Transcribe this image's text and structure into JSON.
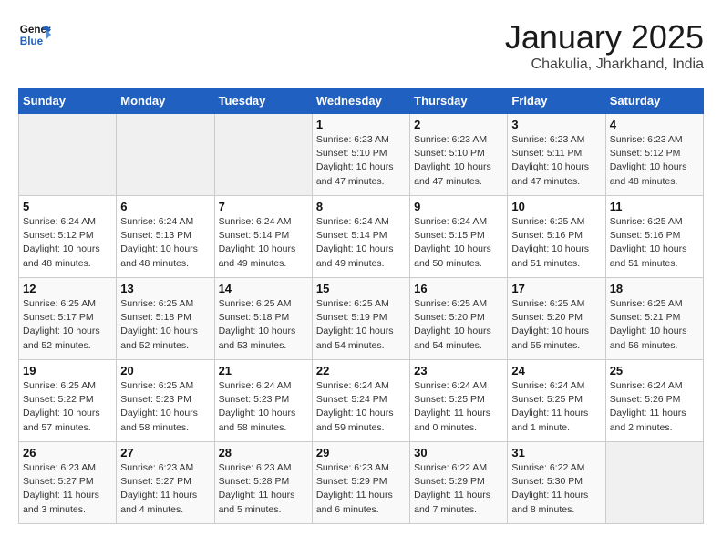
{
  "header": {
    "logo_text_general": "General",
    "logo_text_blue": "Blue",
    "title": "January 2025",
    "subtitle": "Chakulia, Jharkhand, India"
  },
  "days_of_week": [
    "Sunday",
    "Monday",
    "Tuesday",
    "Wednesday",
    "Thursday",
    "Friday",
    "Saturday"
  ],
  "weeks": [
    [
      {
        "day": "",
        "info": ""
      },
      {
        "day": "",
        "info": ""
      },
      {
        "day": "",
        "info": ""
      },
      {
        "day": "1",
        "info": "Sunrise: 6:23 AM\nSunset: 5:10 PM\nDaylight: 10 hours\nand 47 minutes."
      },
      {
        "day": "2",
        "info": "Sunrise: 6:23 AM\nSunset: 5:10 PM\nDaylight: 10 hours\nand 47 minutes."
      },
      {
        "day": "3",
        "info": "Sunrise: 6:23 AM\nSunset: 5:11 PM\nDaylight: 10 hours\nand 47 minutes."
      },
      {
        "day": "4",
        "info": "Sunrise: 6:23 AM\nSunset: 5:12 PM\nDaylight: 10 hours\nand 48 minutes."
      }
    ],
    [
      {
        "day": "5",
        "info": "Sunrise: 6:24 AM\nSunset: 5:12 PM\nDaylight: 10 hours\nand 48 minutes."
      },
      {
        "day": "6",
        "info": "Sunrise: 6:24 AM\nSunset: 5:13 PM\nDaylight: 10 hours\nand 48 minutes."
      },
      {
        "day": "7",
        "info": "Sunrise: 6:24 AM\nSunset: 5:14 PM\nDaylight: 10 hours\nand 49 minutes."
      },
      {
        "day": "8",
        "info": "Sunrise: 6:24 AM\nSunset: 5:14 PM\nDaylight: 10 hours\nand 49 minutes."
      },
      {
        "day": "9",
        "info": "Sunrise: 6:24 AM\nSunset: 5:15 PM\nDaylight: 10 hours\nand 50 minutes."
      },
      {
        "day": "10",
        "info": "Sunrise: 6:25 AM\nSunset: 5:16 PM\nDaylight: 10 hours\nand 51 minutes."
      },
      {
        "day": "11",
        "info": "Sunrise: 6:25 AM\nSunset: 5:16 PM\nDaylight: 10 hours\nand 51 minutes."
      }
    ],
    [
      {
        "day": "12",
        "info": "Sunrise: 6:25 AM\nSunset: 5:17 PM\nDaylight: 10 hours\nand 52 minutes."
      },
      {
        "day": "13",
        "info": "Sunrise: 6:25 AM\nSunset: 5:18 PM\nDaylight: 10 hours\nand 52 minutes."
      },
      {
        "day": "14",
        "info": "Sunrise: 6:25 AM\nSunset: 5:18 PM\nDaylight: 10 hours\nand 53 minutes."
      },
      {
        "day": "15",
        "info": "Sunrise: 6:25 AM\nSunset: 5:19 PM\nDaylight: 10 hours\nand 54 minutes."
      },
      {
        "day": "16",
        "info": "Sunrise: 6:25 AM\nSunset: 5:20 PM\nDaylight: 10 hours\nand 54 minutes."
      },
      {
        "day": "17",
        "info": "Sunrise: 6:25 AM\nSunset: 5:20 PM\nDaylight: 10 hours\nand 55 minutes."
      },
      {
        "day": "18",
        "info": "Sunrise: 6:25 AM\nSunset: 5:21 PM\nDaylight: 10 hours\nand 56 minutes."
      }
    ],
    [
      {
        "day": "19",
        "info": "Sunrise: 6:25 AM\nSunset: 5:22 PM\nDaylight: 10 hours\nand 57 minutes."
      },
      {
        "day": "20",
        "info": "Sunrise: 6:25 AM\nSunset: 5:23 PM\nDaylight: 10 hours\nand 58 minutes."
      },
      {
        "day": "21",
        "info": "Sunrise: 6:24 AM\nSunset: 5:23 PM\nDaylight: 10 hours\nand 58 minutes."
      },
      {
        "day": "22",
        "info": "Sunrise: 6:24 AM\nSunset: 5:24 PM\nDaylight: 10 hours\nand 59 minutes."
      },
      {
        "day": "23",
        "info": "Sunrise: 6:24 AM\nSunset: 5:25 PM\nDaylight: 11 hours\nand 0 minutes."
      },
      {
        "day": "24",
        "info": "Sunrise: 6:24 AM\nSunset: 5:25 PM\nDaylight: 11 hours\nand 1 minute."
      },
      {
        "day": "25",
        "info": "Sunrise: 6:24 AM\nSunset: 5:26 PM\nDaylight: 11 hours\nand 2 minutes."
      }
    ],
    [
      {
        "day": "26",
        "info": "Sunrise: 6:23 AM\nSunset: 5:27 PM\nDaylight: 11 hours\nand 3 minutes."
      },
      {
        "day": "27",
        "info": "Sunrise: 6:23 AM\nSunset: 5:27 PM\nDaylight: 11 hours\nand 4 minutes."
      },
      {
        "day": "28",
        "info": "Sunrise: 6:23 AM\nSunset: 5:28 PM\nDaylight: 11 hours\nand 5 minutes."
      },
      {
        "day": "29",
        "info": "Sunrise: 6:23 AM\nSunset: 5:29 PM\nDaylight: 11 hours\nand 6 minutes."
      },
      {
        "day": "30",
        "info": "Sunrise: 6:22 AM\nSunset: 5:29 PM\nDaylight: 11 hours\nand 7 minutes."
      },
      {
        "day": "31",
        "info": "Sunrise: 6:22 AM\nSunset: 5:30 PM\nDaylight: 11 hours\nand 8 minutes."
      },
      {
        "day": "",
        "info": ""
      }
    ]
  ]
}
